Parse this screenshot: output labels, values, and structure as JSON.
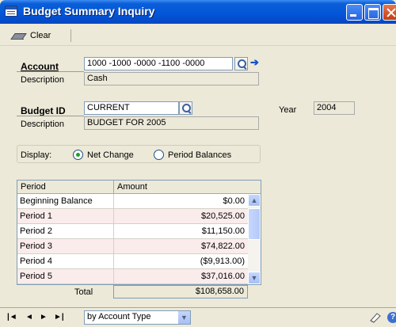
{
  "window": {
    "title": "Budget Summary Inquiry"
  },
  "toolbar": {
    "clear_label": "Clear"
  },
  "account": {
    "label": "Account",
    "value": "1000 -1000 -0000 -1100 -0000",
    "description_label": "Description",
    "description_value": "Cash"
  },
  "budget": {
    "label": "Budget ID",
    "value": "CURRENT",
    "description_label": "Description",
    "description_value": "BUDGET FOR 2005",
    "year_label": "Year",
    "year_value": "2004"
  },
  "display": {
    "label": "Display:",
    "options": [
      "Net Change",
      "Period Balances"
    ],
    "selected": "Net Change"
  },
  "grid": {
    "columns": [
      "Period",
      "Amount"
    ],
    "rows": [
      {
        "period": "Beginning Balance",
        "amount": "$0.00"
      },
      {
        "period": "Period 1",
        "amount": "$20,525.00"
      },
      {
        "period": "Period 2",
        "amount": "$11,150.00"
      },
      {
        "period": "Period 3",
        "amount": "$74,822.00"
      },
      {
        "period": "Period 4",
        "amount": "($9,913.00)"
      },
      {
        "period": "Period 5",
        "amount": "$37,016.00"
      }
    ],
    "total_label": "Total",
    "total_value": "$108,658.00"
  },
  "bottombar": {
    "nav_first": "|◄",
    "nav_prev": "◄",
    "nav_next": "►",
    "nav_last": "►|",
    "sort_value": "by Account Type",
    "help_glyph": "?"
  },
  "icons": {
    "lookup": "magnifier-icon",
    "expand": "arrow-right-icon",
    "clear": "eraser-icon",
    "note": "note-icon",
    "help": "help-icon"
  }
}
